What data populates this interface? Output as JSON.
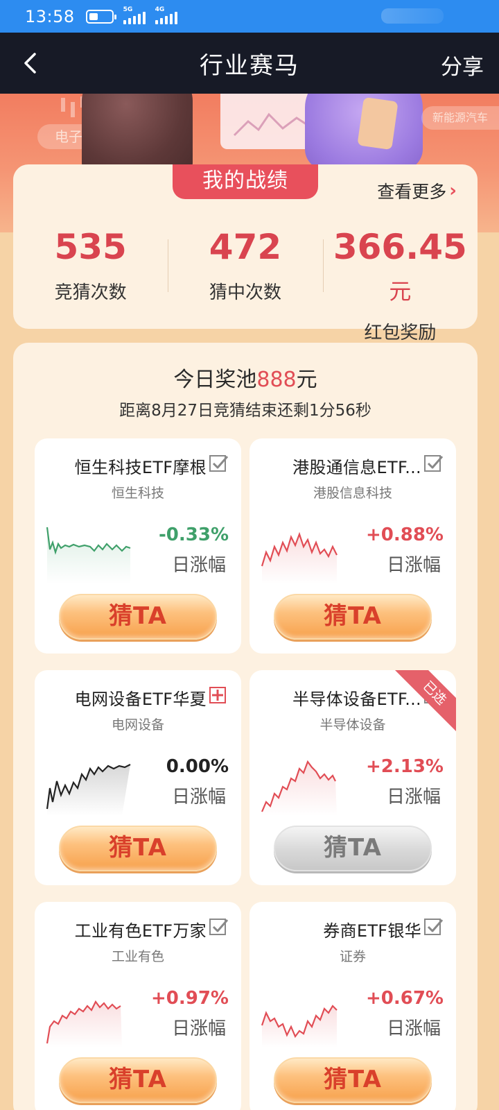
{
  "status_bar": {
    "time": "13:58",
    "network_1": "5G",
    "network_2": "4G"
  },
  "nav": {
    "title": "行业赛马",
    "share_label": "分享",
    "back_icon": "chevron-left-icon"
  },
  "banner": {
    "tag_left": "电子",
    "tag_right": "新能源汽车"
  },
  "stats": {
    "ribbon_title": "我的战绩",
    "more_label": "查看更多",
    "items": [
      {
        "value": "535",
        "unit": "",
        "label": "竞猜次数"
      },
      {
        "value": "472",
        "unit": "",
        "label": "猜中次数"
      },
      {
        "value": "366.45",
        "unit": "元",
        "label": "红包奖励"
      }
    ]
  },
  "pool": {
    "title_prefix": "今日奖池",
    "amount": "888",
    "title_suffix": "元",
    "countdown": "距离8月27日竞猜结束还剩1分56秒"
  },
  "colors": {
    "up": "#e14d55",
    "down": "#3fa06a",
    "flat": "#222222",
    "accent": "#e8505c"
  },
  "etfs": [
    {
      "name": "恒生科技ETF摩根",
      "sector": "恒生科技",
      "change": "-0.33%",
      "change_label": "日涨幅",
      "button": "猜TA",
      "selected": false,
      "trend": "down",
      "check": "check-icon"
    },
    {
      "name": "港股通信息ETF...",
      "sector": "港股信息科技",
      "change": "+0.88%",
      "change_label": "日涨幅",
      "button": "猜TA",
      "selected": false,
      "trend": "up",
      "check": "check-icon"
    },
    {
      "name": "电网设备ETF华夏",
      "sector": "电网设备",
      "change": "0.00%",
      "change_label": "日涨幅",
      "button": "猜TA",
      "selected": false,
      "trend": "flat",
      "check": "plus-icon"
    },
    {
      "name": "半导体设备ETF...",
      "sector": "半导体设备",
      "change": "+2.13%",
      "change_label": "日涨幅",
      "button": "猜TA",
      "selected": true,
      "selected_label": "已选",
      "trend": "up",
      "check": "check-icon"
    },
    {
      "name": "工业有色ETF万家",
      "sector": "工业有色",
      "change": "+0.97%",
      "change_label": "日涨幅",
      "button": "猜TA",
      "selected": false,
      "trend": "up",
      "check": "check-icon"
    },
    {
      "name": "券商ETF银华",
      "sector": "证券",
      "change": "+0.67%",
      "change_label": "日涨幅",
      "button": "猜TA",
      "selected": false,
      "trend": "up",
      "check": "check-icon"
    }
  ]
}
